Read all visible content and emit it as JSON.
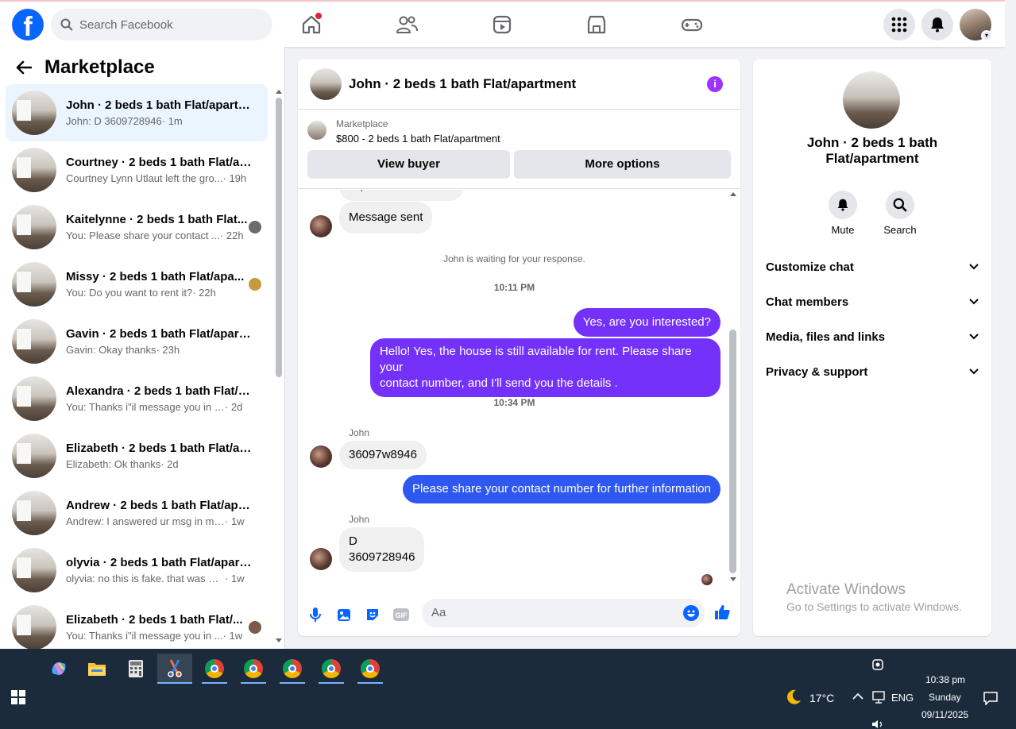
{
  "topbar": {
    "search_placeholder": "Search Facebook",
    "logo_letter": "f"
  },
  "left": {
    "title": "Marketplace",
    "conversations": [
      {
        "name": "John · 2 beds 1 bath Flat/apartm...",
        "msg": "John: D 3609728946",
        "time": "· 1m",
        "active": true
      },
      {
        "name": "Courtney · 2 beds 1 bath Flat/ap...",
        "msg": "Courtney Lynn Utlaut left the gro...",
        "time": " · 19h"
      },
      {
        "name": "Kaitelynne · 2 beds 1 bath Flat...",
        "msg": "You: Please share your contact ...",
        "time": " · 22h"
      },
      {
        "name": "Missy · 2 beds 1 bath Flat/apa...",
        "msg": "You: Do you want to rent it?",
        "time": " · 22h"
      },
      {
        "name": "Gavin · 2 beds 1 bath Flat/apart...",
        "msg": "Gavin: Okay thanks",
        "time": " · 23h"
      },
      {
        "name": "Alexandra · 2 beds 1 bath Flat/a...",
        "msg": "You: Thanks i\"il message you in a ...",
        "time": " · 2d"
      },
      {
        "name": "Elizabeth · 2 beds 1 bath Flat/ap...",
        "msg": "Elizabeth: Ok thanks",
        "time": " · 2d"
      },
      {
        "name": "Andrew · 2 beds 1 bath Flat/apar...",
        "msg": "Andrew: I answered ur msg in my ...",
        "time": " · 1w"
      },
      {
        "name": "olyvia · 2 beds 1 bath Flat/apart...",
        "msg": "olyvia: no this is fake. that was my ...",
        "time": " · 1w"
      },
      {
        "name": "Elizabeth · 2 beds 1 bath Flat/...",
        "msg": "You: Thanks i\"il message you in ...",
        "time": " · 1w"
      }
    ]
  },
  "chat": {
    "title": "John · 2 beds 1 bath Flat/apartment",
    "card_label": "Marketplace",
    "card_price": "$800 - 2 beds 1 bath Flat/apartment",
    "view_buyer": "View buyer",
    "more_options": "More options",
    "partial_msg": "Hi, is this available?",
    "msg_sent": "Message sent",
    "waiting": "John is waiting for your response.",
    "time1": "10:11 PM",
    "out1": "Yes, are you interested?",
    "out2_line1": "Hello! Yes, the house is still available for rent. Please share your",
    "out2_line2": "contact number, and I'll send you the details .",
    "time2": "10:34 PM",
    "sender": "John",
    "in1": "36097w8946",
    "out3": "Please share your contact number for further information",
    "in2_line1": "D",
    "in2_line2": "3609728946",
    "composer_placeholder": "Aa"
  },
  "right": {
    "name": "John · 2 beds 1 bath Flat/apartment",
    "mute": "Mute",
    "search": "Search",
    "sections": [
      "Customize chat",
      "Chat members",
      "Media, files and links",
      "Privacy & support"
    ]
  },
  "watermark": {
    "line1": "Activate Windows",
    "line2": "Go to Settings to activate Windows."
  },
  "taskbar": {
    "weather": "17°C",
    "lang": "ENG",
    "time": "10:38 pm",
    "day": "Sunday",
    "date": "09/11/2025"
  },
  "colors": {
    "brand": "#0866ff",
    "outgoing": "#7431f9",
    "outgoing_blue": "#2f58f0",
    "info": "#a033ff"
  }
}
